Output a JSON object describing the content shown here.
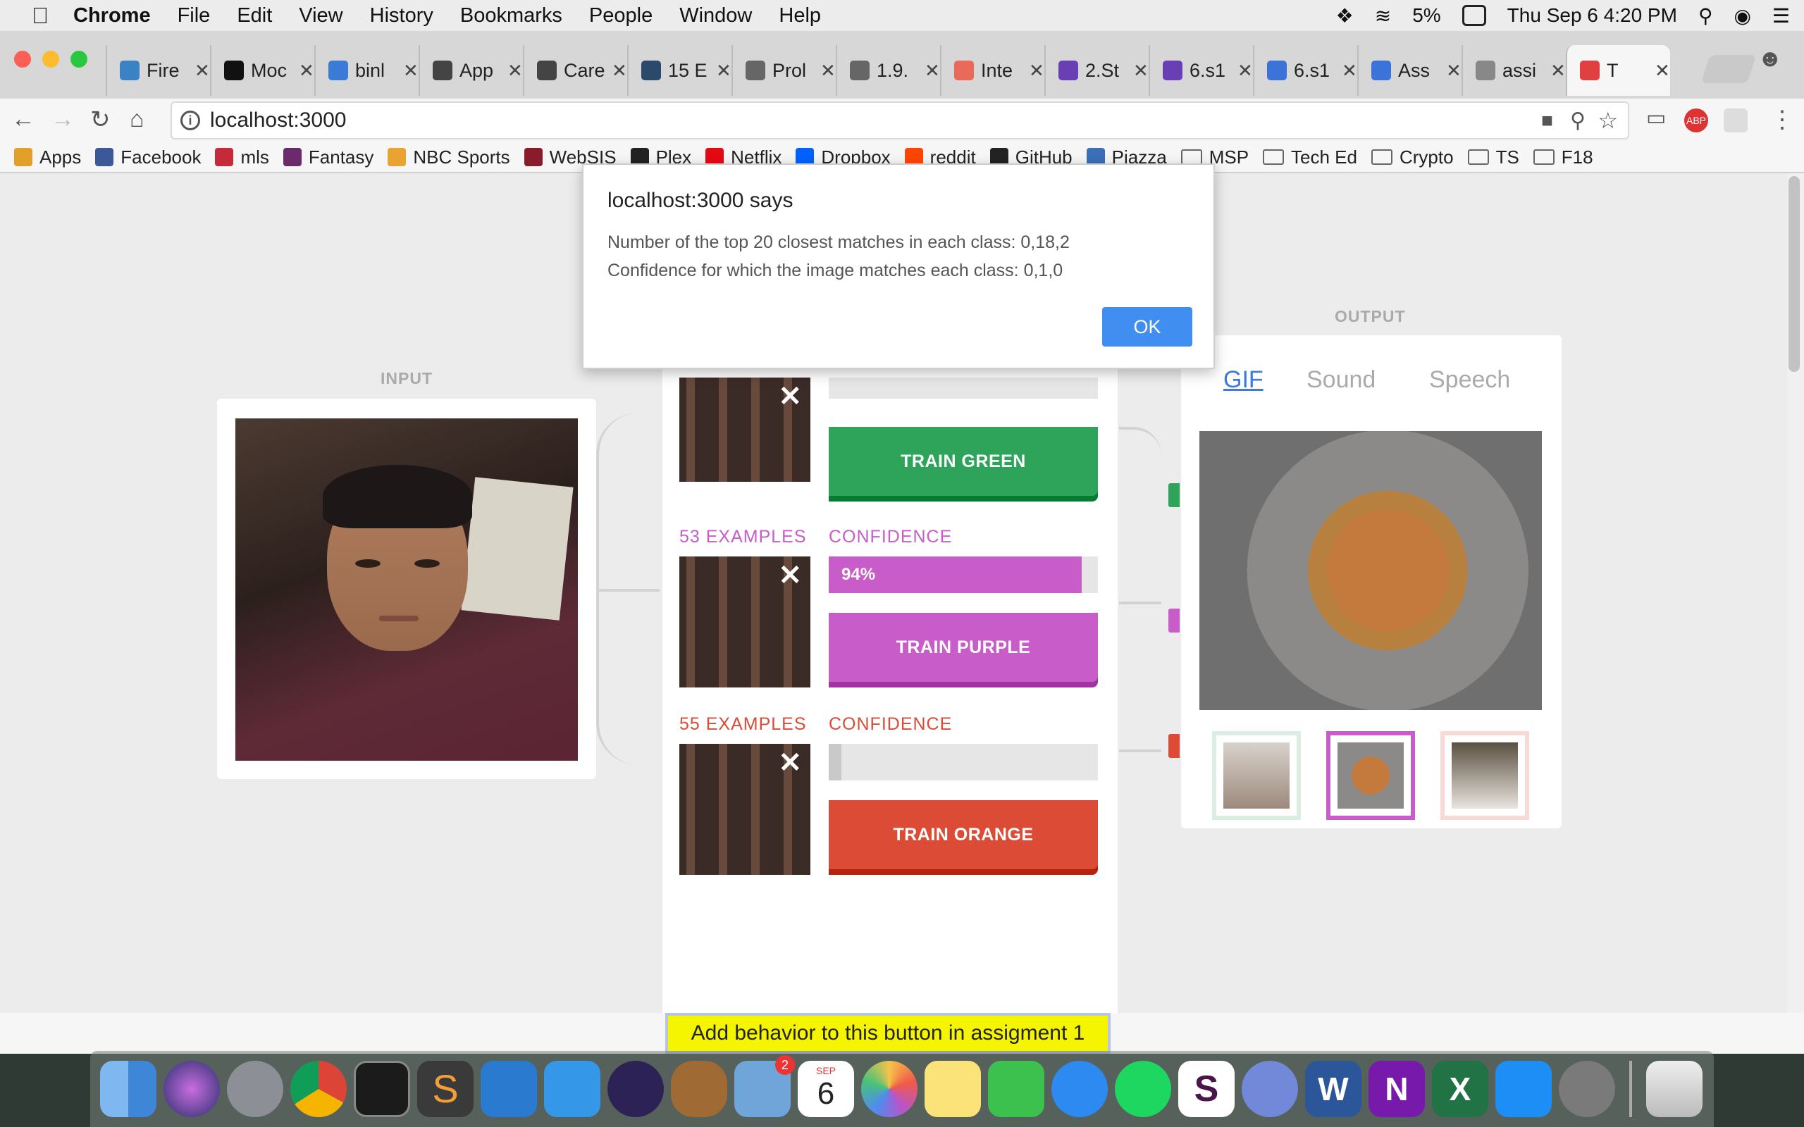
{
  "menubar": {
    "app": "Chrome",
    "items": [
      "File",
      "Edit",
      "View",
      "History",
      "Bookmarks",
      "People",
      "Window",
      "Help"
    ],
    "battery": "5%",
    "datetime": "Thu Sep 6  4:20 PM"
  },
  "tabs": [
    {
      "label": "Fire",
      "color": "#3b82c4",
      "glyph": "fh"
    },
    {
      "label": "Moc",
      "color": "#111111",
      "glyph": "M"
    },
    {
      "label": "binl",
      "color": "#3a7bd5",
      "glyph": ""
    },
    {
      "label": "App",
      "color": "#444444",
      "glyph": ""
    },
    {
      "label": "Care",
      "color": "#444444",
      "glyph": ""
    },
    {
      "label": "15 E",
      "color": "#2b4a6b",
      "glyph": ""
    },
    {
      "label": "Prol",
      "color": "#666666",
      "glyph": ""
    },
    {
      "label": "1.9.",
      "color": "#666666",
      "glyph": ""
    },
    {
      "label": "Inte",
      "color": "#e96a5a",
      "glyph": ""
    },
    {
      "label": "2.St",
      "color": "#6a3fb5",
      "glyph": ""
    },
    {
      "label": "6.s1",
      "color": "#6a3fb5",
      "glyph": ""
    },
    {
      "label": "6.s1",
      "color": "#3b73d9",
      "glyph": ""
    },
    {
      "label": "Ass",
      "color": "#3b73d9",
      "glyph": ""
    },
    {
      "label": "assi",
      "color": "#888888",
      "glyph": ""
    },
    {
      "label": "T",
      "color": "#e04040",
      "glyph": ""
    }
  ],
  "address": {
    "url": "localhost:3000"
  },
  "bookmarks": [
    "Apps",
    "Facebook",
    "mls",
    "Fantasy",
    "NBC Sports",
    "WebSIS",
    "Plex",
    "Netflix",
    "Dropbox",
    "reddit",
    "GitHub",
    "Piazza"
  ],
  "bookmark_folders": [
    "MSP",
    "Tech Ed",
    "Crypto",
    "TS",
    "F18"
  ],
  "page": {
    "input_label": "INPUT",
    "output_label": "OUTPUT",
    "classes": [
      {
        "examples": "",
        "confidence_label": "",
        "confidence": 0,
        "confidence_text": "",
        "button": "TRAIN GREEN",
        "color": "#2da45a"
      },
      {
        "examples": "53 EXAMPLES",
        "confidence_label": "CONFIDENCE",
        "confidence": 0.94,
        "confidence_text": "94%",
        "button": "TRAIN PURPLE",
        "color": "#c85cc8"
      },
      {
        "examples": "55 EXAMPLES",
        "confidence_label": "CONFIDENCE",
        "confidence": 0.02,
        "confidence_text": "",
        "button": "TRAIN ORANGE",
        "color": "#dc4b35"
      }
    ],
    "output_tabs": [
      "GIF",
      "Sound",
      "Speech"
    ],
    "output_thumb_colors": [
      "#dbeee3",
      "#c85cc8",
      "#f7d9d6"
    ]
  },
  "dialog": {
    "title": "localhost:3000 says",
    "line1": "Number of the top 20 closest matches in each class: 0,18,2",
    "line2": "Confidence for which the image matches each class: 0,1,0",
    "ok": "OK"
  },
  "bottom_button": "Add behavior to this button in assigment 1",
  "dock": {
    "badge_mail": "2",
    "calendar_month": "SEP",
    "calendar_day": "6"
  }
}
